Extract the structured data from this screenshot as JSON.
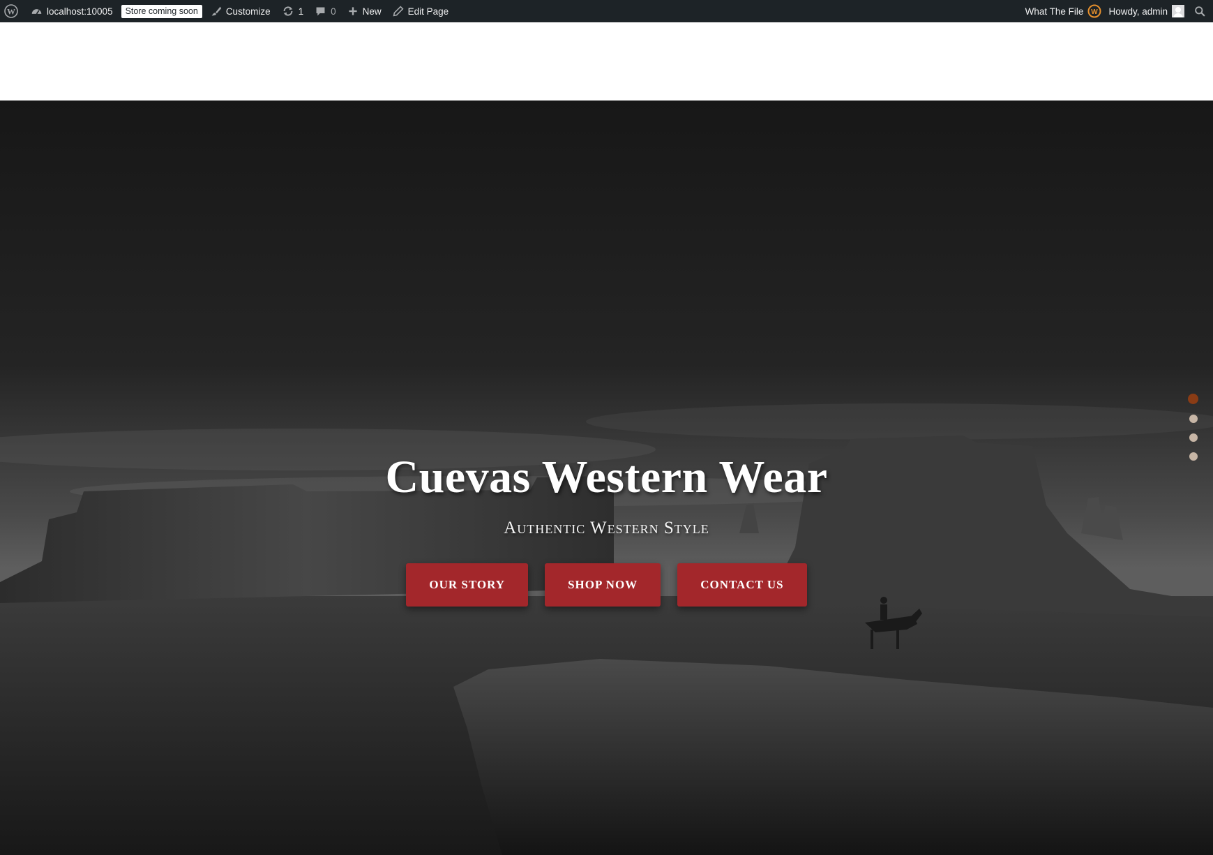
{
  "adminbar": {
    "site_name": "localhost:10005",
    "store_badge": "Store coming soon",
    "customize": "Customize",
    "updates_count": "1",
    "comments_count": "0",
    "new_label": "New",
    "edit_page": "Edit Page",
    "what_the_file": "What The File",
    "howdy": "Howdy, admin"
  },
  "hero": {
    "title": "Cuevas Western Wear",
    "subtitle": "Authentic Western Style",
    "buttons": [
      {
        "label": "OUR STORY"
      },
      {
        "label": "SHOP NOW"
      },
      {
        "label": "CONTACT US"
      }
    ],
    "slides_total": 4,
    "active_slide": 1
  },
  "colors": {
    "adminbar_bg": "#1d2327",
    "button_red": "#a3272b",
    "dot_active": "#8a3c15",
    "dot_inactive": "#c7b6a6"
  },
  "icons": [
    "wordpress-logo-icon",
    "dashboard-icon",
    "brush-icon",
    "updates-icon",
    "comment-icon",
    "plus-icon",
    "pencil-icon",
    "what-the-file-icon",
    "avatar",
    "search-icon"
  ]
}
